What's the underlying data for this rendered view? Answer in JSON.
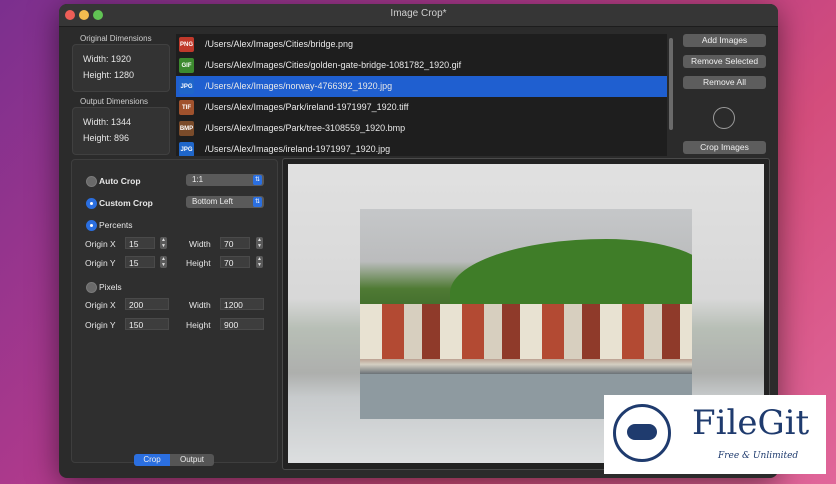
{
  "window": {
    "title": "Image Crop*"
  },
  "original": {
    "group_label": "Original Dimensions",
    "width_text": "Width: 1920",
    "height_text": "Height: 1280"
  },
  "output": {
    "group_label": "Output Dimensions",
    "width_text": "Width: 1344",
    "height_text": "Height: 896"
  },
  "files": [
    {
      "type": "PNG",
      "color": "#c0392b",
      "path": "/Users/Alex/Images/Cities/bridge.png"
    },
    {
      "type": "GIF",
      "color": "#3c8a2e",
      "path": "/Users/Alex/Images/Cities/golden-gate-bridge-1081782_1920.gif"
    },
    {
      "type": "JPG",
      "color": "#1f66c9",
      "path": "/Users/Alex/Images/norway-4766392_1920.jpg"
    },
    {
      "type": "TIF",
      "color": "#a0522d",
      "path": "/Users/Alex/Images/Park/ireland-1971997_1920.tiff"
    },
    {
      "type": "BMP",
      "color": "#7a4b2a",
      "path": "/Users/Alex/Images/Park/tree-3108559_1920.bmp"
    },
    {
      "type": "JPG",
      "color": "#1f66c9",
      "path": "/Users/Alex/Images/ireland-1971997_1920.jpg"
    }
  ],
  "selected_file_index": 2,
  "buttons": {
    "add_images": "Add Images",
    "remove_selected": "Remove Selected",
    "remove_all": "Remove All",
    "crop_images": "Crop Images"
  },
  "crop": {
    "auto_crop_label": "Auto Crop",
    "auto_ratio": "1:1",
    "custom_crop_label": "Custom Crop",
    "custom_anchor": "Bottom Left",
    "percents_label": "Percents",
    "pixels_label": "Pixels",
    "origin_x_label": "Origin X",
    "origin_y_label": "Origin Y",
    "width_label": "Width",
    "height_label": "Height",
    "percent_origin_x": "15",
    "percent_origin_y": "15",
    "percent_width": "70",
    "percent_height": "70",
    "pixel_origin_x": "200",
    "pixel_origin_y": "150",
    "pixel_width": "1200",
    "pixel_height": "900",
    "selected_mode": "Custom Crop",
    "selected_unit": "Percents"
  },
  "tabs": {
    "crop": "Crop",
    "output": "Output",
    "active": "Crop"
  },
  "watermark": {
    "brand": "FileGit",
    "tagline": "Free & Unlimited"
  },
  "colors": {
    "accent": "#2b6fe0",
    "selection": "#1f5fd0",
    "brand": "#1f3b6e"
  }
}
